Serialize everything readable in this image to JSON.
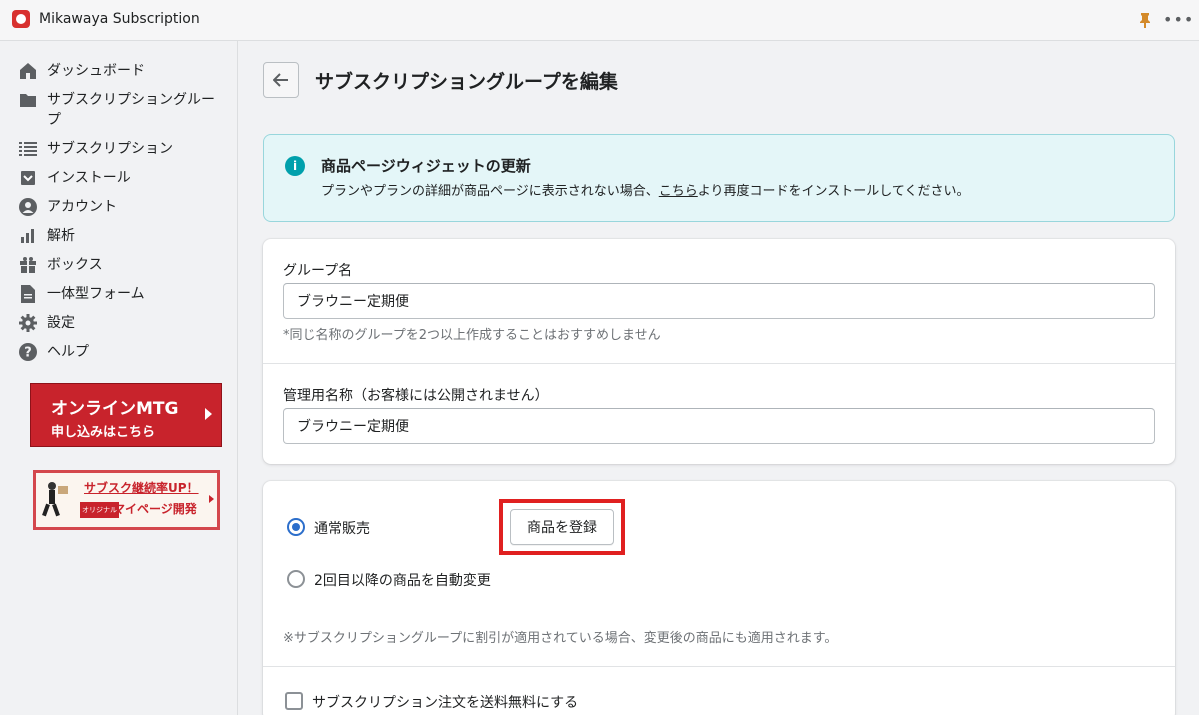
{
  "app": {
    "title": "Mikawaya Subscription"
  },
  "sidebar": {
    "items": [
      {
        "label": "ダッシュボード",
        "icon": "home-icon"
      },
      {
        "label": "サブスクリプショングループ",
        "icon": "folder-icon"
      },
      {
        "label": "サブスクリプション",
        "icon": "list-icon"
      },
      {
        "label": "インストール",
        "icon": "install-icon"
      },
      {
        "label": "アカウント",
        "icon": "account-icon"
      },
      {
        "label": "解析",
        "icon": "analytics-icon"
      },
      {
        "label": "ボックス",
        "icon": "gift-icon"
      },
      {
        "label": "一体型フォーム",
        "icon": "document-icon"
      },
      {
        "label": "設定",
        "icon": "gear-icon"
      },
      {
        "label": "ヘルプ",
        "icon": "help-icon"
      }
    ],
    "banner_mtg": {
      "line1": "オンラインMTG",
      "line2": "申し込みはこちら"
    },
    "banner_mypage": {
      "line1": "サブスク継続率UP！",
      "tag": "オリジナル",
      "line2": "マイページ開発"
    }
  },
  "page": {
    "title": "サブスクリプショングループを編集"
  },
  "info": {
    "title": "商品ページウィジェットの更新",
    "text_before": "プランやプランの詳細が商品ページに表示されない場合、",
    "link": "こちら",
    "text_after": "より再度コードをインストールしてください。"
  },
  "group_form": {
    "name_label": "グループ名",
    "name_value": "ブラウニー定期便",
    "name_help": "*同じ名称のグループを2つ以上作成することはおすすめしません",
    "admin_label": "管理用名称（お客様には公開されません）",
    "admin_value": "ブラウニー定期便"
  },
  "sales": {
    "option_normal": "通常販売",
    "register_button": "商品を登録",
    "option_auto": "2回目以降の商品を自動変更",
    "note": "※サブスクリプショングループに割引が適用されている場合、変更後の商品にも適用されます。",
    "free_shipping": "サブスクリプション注文を送料無料にする"
  },
  "colors": {
    "accent": "#2c6ecb",
    "highlight": "#e02020",
    "brand_red": "#c8232c",
    "info_bg": "#e4f6f8"
  }
}
